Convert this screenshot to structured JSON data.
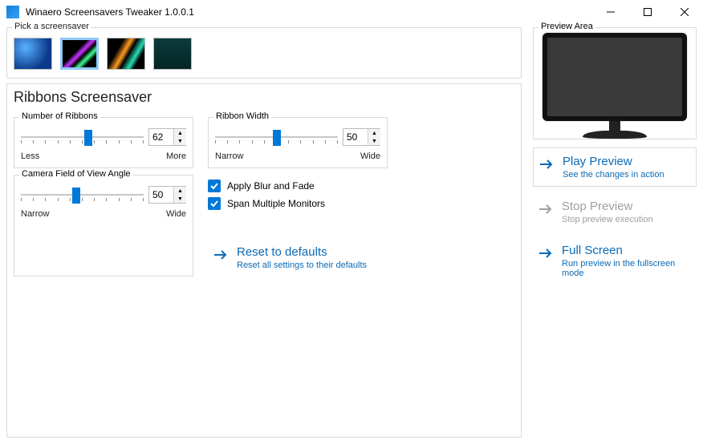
{
  "titlebar": {
    "title": "Winaero Screensavers Tweaker 1.0.0.1"
  },
  "picker": {
    "legend": "Pick a screensaver",
    "selected_index": 1
  },
  "section_title": "Ribbons Screensaver",
  "sliders": {
    "number": {
      "legend": "Number of Ribbons",
      "value": "62",
      "min_label": "Less",
      "max_label": "More",
      "percent": 55
    },
    "width": {
      "legend": "Ribbon Width",
      "value": "50",
      "min_label": "Narrow",
      "max_label": "Wide",
      "percent": 50
    },
    "fov": {
      "legend": "Camera Field of View Angle",
      "value": "50",
      "min_label": "Narrow",
      "max_label": "Wide",
      "percent": 45
    }
  },
  "checks": {
    "blur": "Apply Blur and Fade",
    "span": "Span Multiple Monitors"
  },
  "reset": {
    "title": "Reset to defaults",
    "sub": "Reset all settings to their defaults"
  },
  "preview_area": {
    "legend": "Preview Area"
  },
  "play": {
    "title": "Play Preview",
    "sub": "See the changes in action"
  },
  "stop": {
    "title": "Stop Preview",
    "sub": "Stop preview execution"
  },
  "full": {
    "title": "Full Screen",
    "sub": "Run preview in the fullscreen mode"
  }
}
